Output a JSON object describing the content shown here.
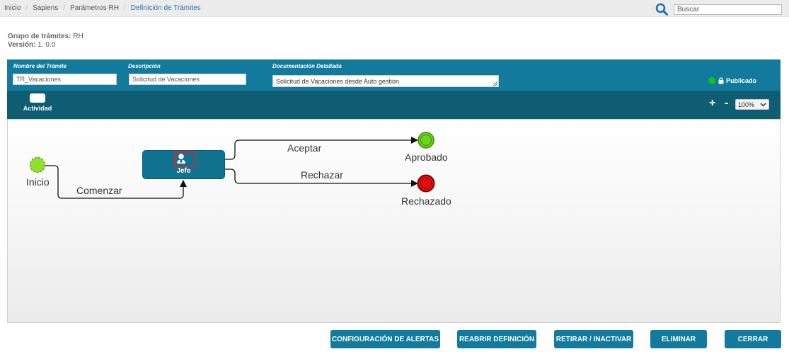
{
  "breadcrumb": [
    "Inicio",
    "Sapiens",
    "Parámetros RH",
    "Definición de Trámites"
  ],
  "search": {
    "placeholder": "Buscar"
  },
  "meta": {
    "group_label": "Grupo de trámites:",
    "group_value": "RH",
    "version_label": "Versión:",
    "version_value": "1. 0.0"
  },
  "form": {
    "name_label": "Nombre del Trámite",
    "name_value": "TR_Vacaciones",
    "desc_label": "Descripción",
    "desc_value": "Solicitud de Vacaciones",
    "doc_label": "Documentación Detallada",
    "doc_value": "Solicitud de Vacaciones desde Auto gestión",
    "status": "Publicado",
    "status_color": "#14c414"
  },
  "toolbar": {
    "activity_label": "Actividad",
    "zoom_in": "+",
    "zoom_out": "-",
    "zoom_value": "100%"
  },
  "diagram": {
    "start_label": "Inicio",
    "activity_label": "Jefe",
    "flow_start_label": "Comenzar",
    "flow_accept_label": "Aceptar",
    "flow_reject_label": "Rechazar",
    "end_ok_label": "Aprobado",
    "end_ko_label": "Rechazado",
    "start_color": "#8ee02c",
    "end_ok_color": "#6bd41e",
    "end_ko_color": "#e01010"
  },
  "buttons": {
    "alerts": "CONFIGURACIÓN DE ALERTAS",
    "reopen": "REABRIR DEFINICIÓN",
    "retire": "RETIRAR / INACTIVAR",
    "delete": "ELIMINAR",
    "close": "CERRAR"
  }
}
